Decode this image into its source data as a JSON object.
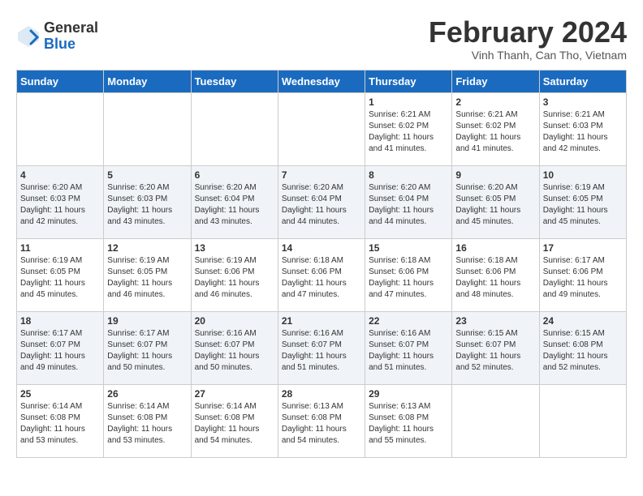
{
  "header": {
    "logo_general": "General",
    "logo_blue": "Blue",
    "month_title": "February 2024",
    "subtitle": "Vinh Thanh, Can Tho, Vietnam"
  },
  "days_of_week": [
    "Sunday",
    "Monday",
    "Tuesday",
    "Wednesday",
    "Thursday",
    "Friday",
    "Saturday"
  ],
  "weeks": [
    [
      {
        "day": "",
        "info": ""
      },
      {
        "day": "",
        "info": ""
      },
      {
        "day": "",
        "info": ""
      },
      {
        "day": "",
        "info": ""
      },
      {
        "day": "1",
        "info": "Sunrise: 6:21 AM\nSunset: 6:02 PM\nDaylight: 11 hours and 41 minutes."
      },
      {
        "day": "2",
        "info": "Sunrise: 6:21 AM\nSunset: 6:02 PM\nDaylight: 11 hours and 41 minutes."
      },
      {
        "day": "3",
        "info": "Sunrise: 6:21 AM\nSunset: 6:03 PM\nDaylight: 11 hours and 42 minutes."
      }
    ],
    [
      {
        "day": "4",
        "info": "Sunrise: 6:20 AM\nSunset: 6:03 PM\nDaylight: 11 hours and 42 minutes."
      },
      {
        "day": "5",
        "info": "Sunrise: 6:20 AM\nSunset: 6:03 PM\nDaylight: 11 hours and 43 minutes."
      },
      {
        "day": "6",
        "info": "Sunrise: 6:20 AM\nSunset: 6:04 PM\nDaylight: 11 hours and 43 minutes."
      },
      {
        "day": "7",
        "info": "Sunrise: 6:20 AM\nSunset: 6:04 PM\nDaylight: 11 hours and 44 minutes."
      },
      {
        "day": "8",
        "info": "Sunrise: 6:20 AM\nSunset: 6:04 PM\nDaylight: 11 hours and 44 minutes."
      },
      {
        "day": "9",
        "info": "Sunrise: 6:20 AM\nSunset: 6:05 PM\nDaylight: 11 hours and 45 minutes."
      },
      {
        "day": "10",
        "info": "Sunrise: 6:19 AM\nSunset: 6:05 PM\nDaylight: 11 hours and 45 minutes."
      }
    ],
    [
      {
        "day": "11",
        "info": "Sunrise: 6:19 AM\nSunset: 6:05 PM\nDaylight: 11 hours and 45 minutes."
      },
      {
        "day": "12",
        "info": "Sunrise: 6:19 AM\nSunset: 6:05 PM\nDaylight: 11 hours and 46 minutes."
      },
      {
        "day": "13",
        "info": "Sunrise: 6:19 AM\nSunset: 6:06 PM\nDaylight: 11 hours and 46 minutes."
      },
      {
        "day": "14",
        "info": "Sunrise: 6:18 AM\nSunset: 6:06 PM\nDaylight: 11 hours and 47 minutes."
      },
      {
        "day": "15",
        "info": "Sunrise: 6:18 AM\nSunset: 6:06 PM\nDaylight: 11 hours and 47 minutes."
      },
      {
        "day": "16",
        "info": "Sunrise: 6:18 AM\nSunset: 6:06 PM\nDaylight: 11 hours and 48 minutes."
      },
      {
        "day": "17",
        "info": "Sunrise: 6:17 AM\nSunset: 6:06 PM\nDaylight: 11 hours and 49 minutes."
      }
    ],
    [
      {
        "day": "18",
        "info": "Sunrise: 6:17 AM\nSunset: 6:07 PM\nDaylight: 11 hours and 49 minutes."
      },
      {
        "day": "19",
        "info": "Sunrise: 6:17 AM\nSunset: 6:07 PM\nDaylight: 11 hours and 50 minutes."
      },
      {
        "day": "20",
        "info": "Sunrise: 6:16 AM\nSunset: 6:07 PM\nDaylight: 11 hours and 50 minutes."
      },
      {
        "day": "21",
        "info": "Sunrise: 6:16 AM\nSunset: 6:07 PM\nDaylight: 11 hours and 51 minutes."
      },
      {
        "day": "22",
        "info": "Sunrise: 6:16 AM\nSunset: 6:07 PM\nDaylight: 11 hours and 51 minutes."
      },
      {
        "day": "23",
        "info": "Sunrise: 6:15 AM\nSunset: 6:07 PM\nDaylight: 11 hours and 52 minutes."
      },
      {
        "day": "24",
        "info": "Sunrise: 6:15 AM\nSunset: 6:08 PM\nDaylight: 11 hours and 52 minutes."
      }
    ],
    [
      {
        "day": "25",
        "info": "Sunrise: 6:14 AM\nSunset: 6:08 PM\nDaylight: 11 hours and 53 minutes."
      },
      {
        "day": "26",
        "info": "Sunrise: 6:14 AM\nSunset: 6:08 PM\nDaylight: 11 hours and 53 minutes."
      },
      {
        "day": "27",
        "info": "Sunrise: 6:14 AM\nSunset: 6:08 PM\nDaylight: 11 hours and 54 minutes."
      },
      {
        "day": "28",
        "info": "Sunrise: 6:13 AM\nSunset: 6:08 PM\nDaylight: 11 hours and 54 minutes."
      },
      {
        "day": "29",
        "info": "Sunrise: 6:13 AM\nSunset: 6:08 PM\nDaylight: 11 hours and 55 minutes."
      },
      {
        "day": "",
        "info": ""
      },
      {
        "day": "",
        "info": ""
      }
    ]
  ]
}
